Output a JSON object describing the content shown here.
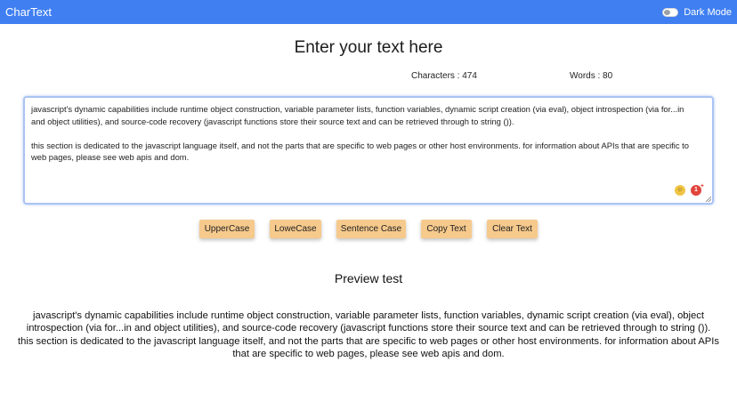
{
  "navbar": {
    "brand": "CharText",
    "dark_mode_label": "Dark Mode"
  },
  "main": {
    "heading": "Enter your text here",
    "characters_stat": "Characters : 474",
    "words_stat": "Words : 80",
    "textarea_value": "javascript's dynamic capabilities include runtime object construction, variable parameter lists, function variables, dynamic script creation (via eval), object introspection (via for...in\nand object utilities), and source-code recovery (javascript functions store their source text and can be retrieved through to string ()).\n\nthis section is dedicated to the javascript language itself, and not the parts that are specific to web pages or other host environments. for information about APIs that are specific to\nweb pages, please see web apis and dom.",
    "buttons": {
      "uppercase": "UpperCase",
      "lowercase": "LoweCase",
      "sentence_case": "Sentence Case",
      "copy_text": "Copy Text",
      "clear_text": "Clear Text"
    }
  },
  "preview": {
    "title": "Preview test",
    "text": "javascript's dynamic capabilities include runtime object construction, variable parameter lists, function variables, dynamic script creation (via eval), object\nintrospection (via for...in and object utilities), and source-code recovery (javascript functions store their source text and can be retrieved through to string ()).\nthis section is dedicated to the javascript language itself, and not the parts that are specific to web pages or other host environments. for information about APIs\nthat are specific to web pages, please see web apis and dom."
  },
  "colors": {
    "navbar": "#3f7ff2",
    "button": "#f6c98c",
    "textarea_border": "#a9c3f4"
  },
  "icons": [
    "toggle-switch-icon",
    "emoji-icon",
    "grammar-badge-icon",
    "resize-grip-icon"
  ]
}
